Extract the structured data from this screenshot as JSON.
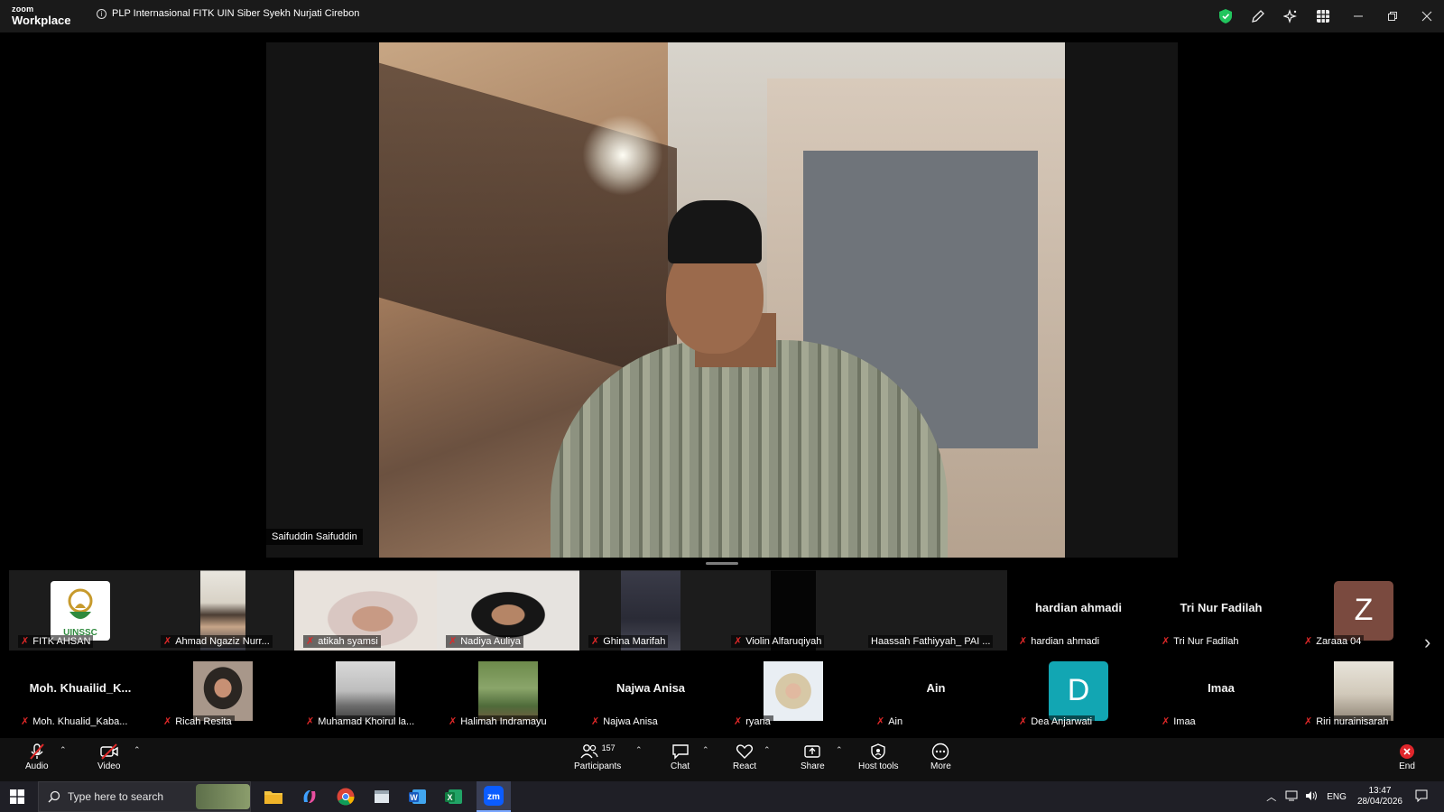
{
  "app": {
    "logo_line1": "zoom",
    "logo_line2": "Workplace",
    "meeting_title": "PLP Internasional FITK UIN Siber Syekh Nurjati Cirebon",
    "shield_color": "#22c55e"
  },
  "speaker": {
    "name": "Saifuddin Saifuddin"
  },
  "gallery": {
    "row1": [
      {
        "name": "FITK AHSAN",
        "type": "logo",
        "logo_text": "UINSSC"
      },
      {
        "name": "Ahmad Ngaziz Nurr...",
        "type": "video"
      },
      {
        "name": "atikah syamsi",
        "type": "video"
      },
      {
        "name": "Nadiya Auliya",
        "type": "video"
      },
      {
        "name": "Ghina Marifah",
        "type": "video"
      },
      {
        "name": "Violin Alfaruqiyah",
        "type": "video"
      },
      {
        "name": "Haassah Fathiyyah_ PAI ...",
        "type": "blank"
      },
      {
        "name": "hardian ahmadi",
        "type": "name",
        "big": "hardian ahmadi"
      },
      {
        "name": "Tri Nur Fadilah",
        "type": "name",
        "big": "Tri Nur Fadilah"
      },
      {
        "name": "Zaraaa 04",
        "type": "letter",
        "letter": "Z",
        "color": "#7a4a3f"
      }
    ],
    "row2": [
      {
        "name": "Moh. Khualid_Kaba...",
        "type": "name",
        "big": "Moh.  Khuailid_K..."
      },
      {
        "name": "Ricah Resita",
        "type": "video"
      },
      {
        "name": "Muhamad Khoirul la...",
        "type": "video"
      },
      {
        "name": "Halimah Indramayu",
        "type": "video"
      },
      {
        "name": "Najwa Anisa",
        "type": "name",
        "big": "Najwa Anisa"
      },
      {
        "name": "ryana",
        "type": "video"
      },
      {
        "name": "Ain",
        "type": "name",
        "big": "Ain"
      },
      {
        "name": "Dea Anjarwati",
        "type": "letter",
        "letter": "D",
        "color": "#12a6b3"
      },
      {
        "name": "Imaa",
        "type": "name",
        "big": "Imaa"
      },
      {
        "name": "Riri nurainisarah",
        "type": "video"
      }
    ]
  },
  "toolbar": {
    "audio": "Audio",
    "video": "Video",
    "participants": "Participants",
    "participants_count": "157",
    "chat": "Chat",
    "react": "React",
    "share": "Share",
    "host_tools": "Host tools",
    "more": "More",
    "end": "End",
    "end_color": "#e0262b"
  },
  "taskbar": {
    "search_placeholder": "Type here to search",
    "language": "ENG",
    "time": "13:47",
    "date": "28/04/2026"
  }
}
